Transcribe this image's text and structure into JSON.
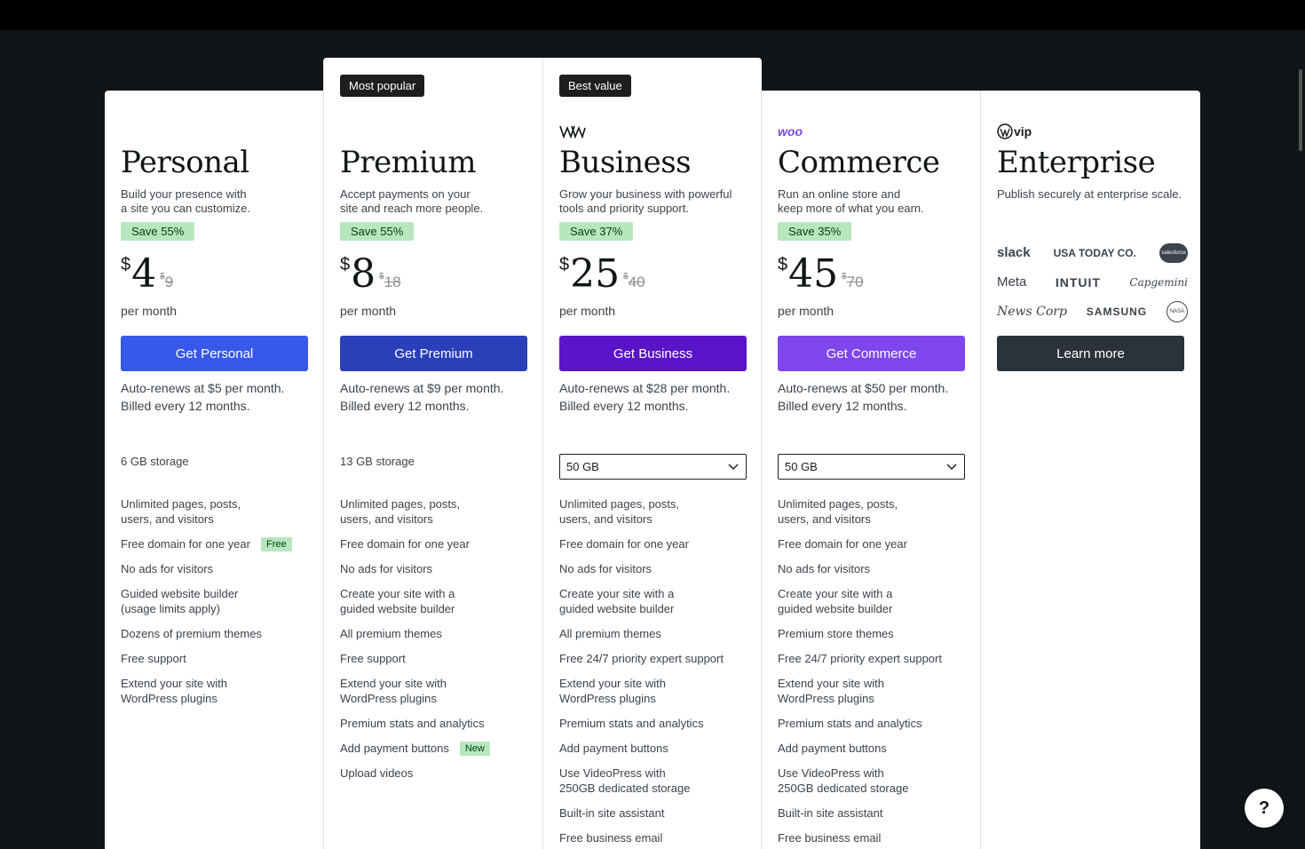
{
  "plans": [
    {
      "title": "Personal",
      "description_lines": [
        "Build your presence with",
        "a site you can customize."
      ],
      "save_badge": "Save 55%",
      "currency": "$",
      "price": "4",
      "old_currency": "$",
      "old_price": "9",
      "per": "per month",
      "cta": "Get Personal",
      "cta_color": "#3858e9",
      "renew_lines": [
        "Auto-renews at $5 per month.",
        "Billed every 12 months."
      ],
      "storage": "6 GB storage",
      "features": [
        {
          "text": [
            "Unlimited pages, posts,",
            "users, and visitors"
          ]
        },
        {
          "text": [
            "Free domain for one year"
          ],
          "tag": "Free"
        },
        {
          "text": [
            "No ads for visitors"
          ]
        },
        {
          "text": [
            "Guided website builder",
            "(usage limits apply)"
          ]
        },
        {
          "text": [
            "Dozens of premium themes"
          ]
        },
        {
          "text": [
            "Free support"
          ]
        },
        {
          "text": [
            "Extend your site with",
            "WordPress plugins"
          ]
        }
      ]
    },
    {
      "top_badge": "Most popular",
      "title": "Premium",
      "description_lines": [
        "Accept payments on your",
        "site and reach more people."
      ],
      "save_badge": "Save 55%",
      "currency": "$",
      "price": "8",
      "old_currency": "$",
      "old_price": "18",
      "per": "per month",
      "cta": "Get Premium",
      "cta_color": "#2a3fb8",
      "renew_lines": [
        "Auto-renews at $9 per month.",
        "Billed every 12 months."
      ],
      "storage": "13 GB storage",
      "features": [
        {
          "text": [
            "Unlimited pages, posts,",
            "users, and visitors"
          ]
        },
        {
          "text": [
            "Free domain for one year"
          ]
        },
        {
          "text": [
            "No ads for visitors"
          ]
        },
        {
          "text": [
            "Create your site with a",
            "guided website builder"
          ]
        },
        {
          "text": [
            "All premium themes"
          ]
        },
        {
          "text": [
            "Free support"
          ]
        },
        {
          "text": [
            "Extend your site with",
            "WordPress plugins"
          ]
        },
        {
          "text": [
            "Premium stats and analytics"
          ]
        },
        {
          "text": [
            "Add payment buttons"
          ],
          "tag": "New"
        },
        {
          "text": [
            "Upload videos"
          ]
        }
      ]
    },
    {
      "top_badge": "Best value",
      "logo": "wp-logo",
      "title": "Business",
      "description_lines": [
        "Grow your business with powerful",
        "tools and priority support."
      ],
      "save_badge": "Save 37%",
      "currency": "$",
      "price": "25",
      "old_currency": "$",
      "old_price": "40",
      "per": "per month",
      "cta": "Get Business",
      "cta_color": "#5a14c8",
      "renew_lines": [
        "Auto-renews at $28 per month.",
        "Billed every 12 months."
      ],
      "storage_select": "50 GB",
      "features": [
        {
          "text": [
            "Unlimited pages, posts,",
            "users, and visitors"
          ]
        },
        {
          "text": [
            "Free domain for one year"
          ]
        },
        {
          "text": [
            "No ads for visitors"
          ]
        },
        {
          "text": [
            "Create your site with a",
            "guided website builder"
          ]
        },
        {
          "text": [
            "All premium themes"
          ]
        },
        {
          "text": [
            "Free 24/7 priority expert support"
          ]
        },
        {
          "text": [
            "Extend your site with",
            "WordPress plugins"
          ]
        },
        {
          "text": [
            "Premium stats and analytics"
          ]
        },
        {
          "text": [
            "Add payment buttons"
          ]
        },
        {
          "text": [
            "Use VideoPress with",
            "250GB dedicated storage"
          ]
        },
        {
          "text": [
            "Built-in site assistant"
          ]
        },
        {
          "text": [
            "Free business email"
          ]
        }
      ]
    },
    {
      "logo": "woo",
      "title": "Commerce",
      "description_lines": [
        "Run an online store and",
        "keep more of what you earn."
      ],
      "save_badge": "Save 35%",
      "currency": "$",
      "price": "45",
      "old_currency": "$",
      "old_price": "70",
      "per": "per month",
      "cta": "Get Commerce",
      "cta_color": "#7f46ee",
      "renew_lines": [
        "Auto-renews at $50 per month.",
        "Billed every 12 months."
      ],
      "storage_select": "50 GB",
      "features": [
        {
          "text": [
            "Unlimited pages, posts,",
            "users, and visitors"
          ]
        },
        {
          "text": [
            "Free domain for one year"
          ]
        },
        {
          "text": [
            "No ads for visitors"
          ]
        },
        {
          "text": [
            "Create your site with a",
            "guided website builder"
          ]
        },
        {
          "text": [
            "Premium store themes"
          ]
        },
        {
          "text": [
            "Free 24/7 priority expert support"
          ]
        },
        {
          "text": [
            "Extend your site with",
            "WordPress plugins"
          ]
        },
        {
          "text": [
            "Premium stats and analytics"
          ]
        },
        {
          "text": [
            "Add payment buttons"
          ]
        },
        {
          "text": [
            "Use VideoPress with",
            "250GB dedicated storage"
          ]
        },
        {
          "text": [
            "Built-in site assistant"
          ]
        },
        {
          "text": [
            "Free business email"
          ]
        }
      ]
    },
    {
      "logo": "vip",
      "title": "Enterprise",
      "description_lines": [
        "Publish securely at enterprise scale."
      ],
      "cta": "Learn more",
      "cta_color": "#2c3338",
      "clients": [
        [
          "slack",
          "USA TODAY CO.",
          "salesforce"
        ],
        [
          "Meta",
          "INTUIT",
          "Capgemini"
        ],
        [
          "News Corp",
          "SAMSUNG",
          "NASA"
        ]
      ]
    }
  ],
  "help_button": "?"
}
